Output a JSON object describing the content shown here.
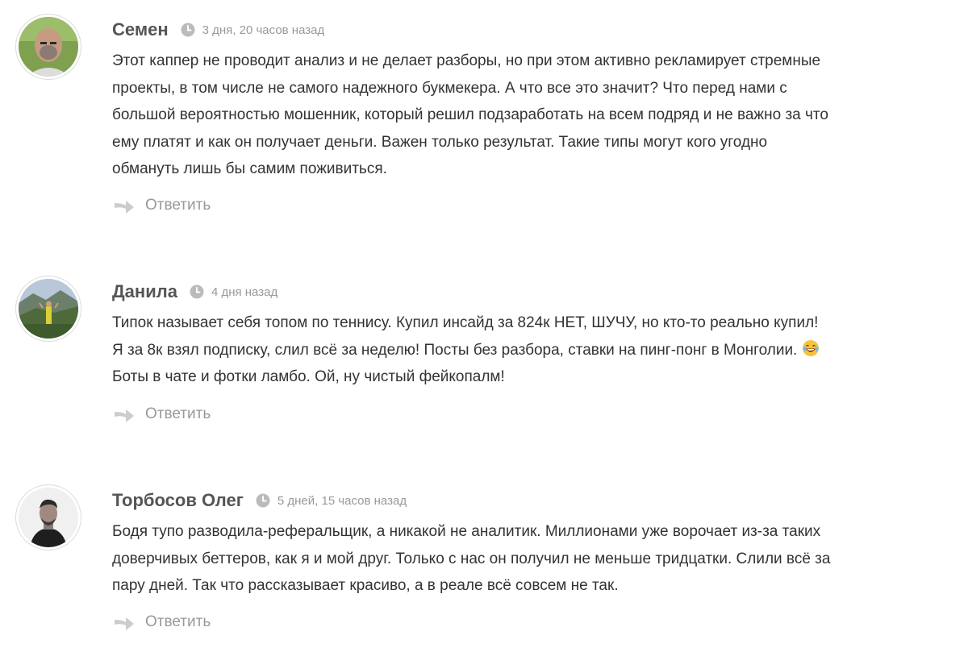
{
  "comments": [
    {
      "author": "Семен",
      "time": "3 дня, 20 часов назад",
      "lines": [
        "Этот каппер не проводит анализ и не делает разборы, но при этом активно рекламирует стремные",
        "проекты, в том числе не самого надежного букмекера. А что все это значит? Что перед нами с",
        "большой вероятностью мошенник, который решил подзаработать на всем подряд и не важно за что",
        "ему платят и как он получает деньги. Важен только результат. Такие типы могут кого угодно",
        "обмануть лишь бы самим поживиться."
      ],
      "reply_label": "Ответить",
      "avatar_icon": "user-photo-bald-man"
    },
    {
      "author": "Данила",
      "time": "4 дня назад",
      "lines": [
        "Типок называет себя топом по теннису. Купил инсайд за 824к НЕТ, ШУЧУ, но кто-то реально купил!",
        "Я за 8к взял подписку, слил всё за неделю! Посты без разбора, ставки на пинг-понг в Монголии.",
        "Боты в чате и фотки ламбо. Ой, ну чистый фейкопалм!"
      ],
      "emoji_icon": "laughing-emoji",
      "reply_label": "Ответить",
      "avatar_icon": "user-photo-mountains"
    },
    {
      "author": "Торбосов Олег",
      "time": "5 дней, 15 часов назад",
      "lines": [
        "Бодя тупо разводила-реферальщик, а никакой не аналитик. Миллионами уже ворочает из-за таких",
        "доверчивых беттеров, как я и мой друг. Только с нас он получил не меньше тридцатки. Слили всё за",
        "пару дней. Так что рассказывает красиво, а в реале всё совсем не так."
      ],
      "reply_label": "Ответить",
      "avatar_icon": "user-photo-man-black-white"
    }
  ],
  "icons": {
    "time": "clock-icon",
    "reply": "reply-arrow-icon"
  },
  "colors": {
    "author": "#555555",
    "meta": "#999999",
    "text": "#333333",
    "icon": "#cccccc"
  }
}
